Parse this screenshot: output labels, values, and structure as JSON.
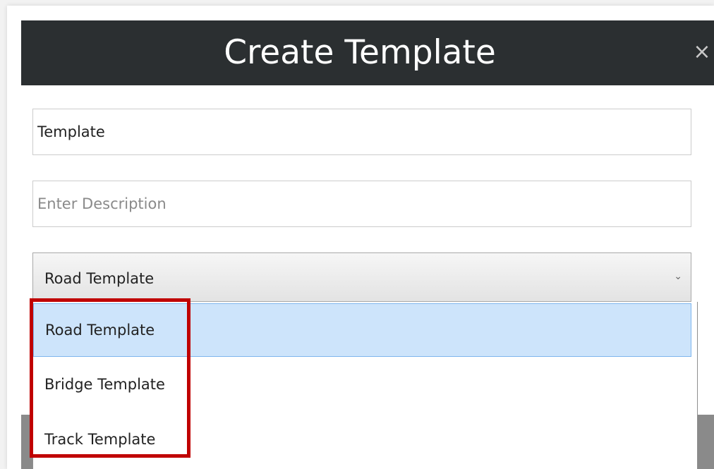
{
  "dialog": {
    "title": "Create Template",
    "close_glyph": "×"
  },
  "form": {
    "name_value": "Template",
    "description_value": "",
    "description_placeholder": "Enter Description",
    "template_type": {
      "selected": "Road Template",
      "chevron_glyph": "⌄",
      "options": [
        "Road Template",
        "Bridge Template",
        "Track Template"
      ]
    }
  },
  "colors": {
    "header_bg": "#2b2f31",
    "selected_option_bg": "#cde4fb",
    "annotation_red": "#c00000"
  },
  "icons": {
    "close": "close-icon",
    "chevron": "chevron-down-icon"
  }
}
